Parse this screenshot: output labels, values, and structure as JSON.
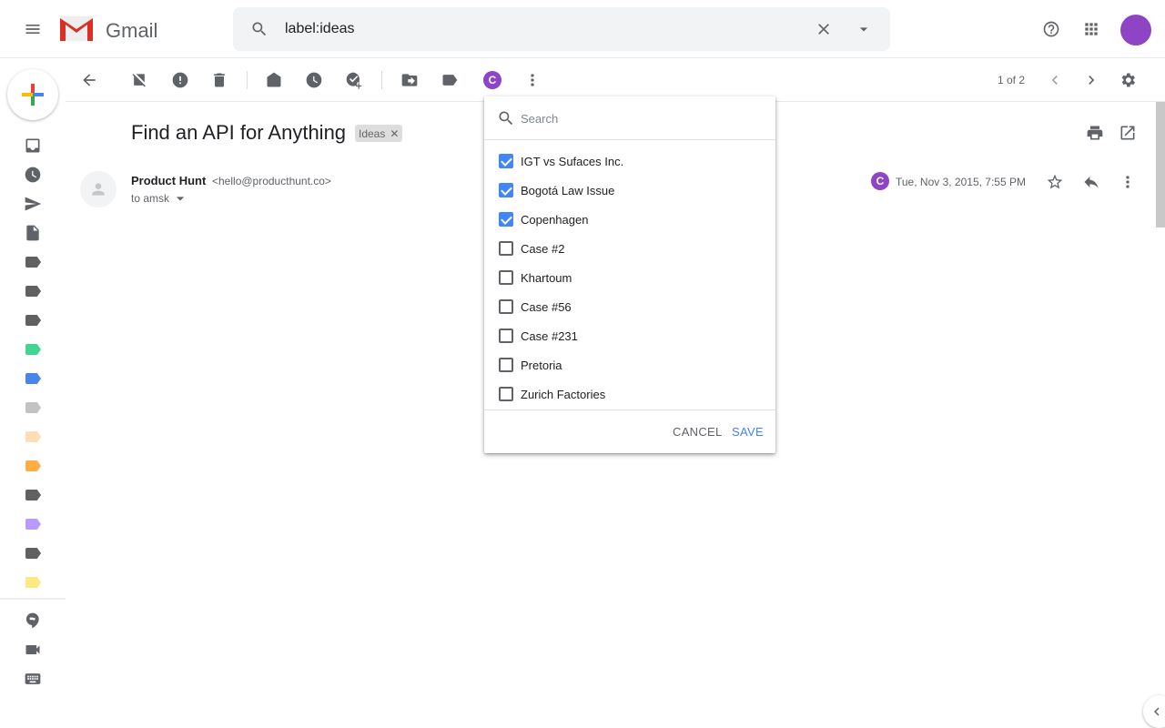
{
  "header": {
    "app_name": "Gmail",
    "search_value": "label:ideas"
  },
  "toolbar": {
    "pagination": "1 of 2",
    "label_avatar": "C"
  },
  "email": {
    "subject": "Find an API for Anything",
    "chip": "Ideas",
    "sender_name": "Product Hunt",
    "sender_email": "<hello@producthunt.co>",
    "to": "to amsk",
    "date": "Tue, Nov 3, 2015, 7:55 PM",
    "avatar_letter": "C"
  },
  "sidebar": {
    "label_colors": [
      "#616161",
      "#616161",
      "#616161",
      "#42d692",
      "#4a86e8",
      "#c2c2c2",
      "#ffdeb5",
      "#ffad47",
      "#616161",
      "#b99aff",
      "#616161",
      "#fbe983"
    ]
  },
  "label_menu": {
    "search_placeholder": "Search",
    "items": [
      {
        "label": "IGT vs Sufaces Inc.",
        "checked": true
      },
      {
        "label": "Bogotá Law Issue",
        "checked": true
      },
      {
        "label": "Copenhagen",
        "checked": true
      },
      {
        "label": "Case #2",
        "checked": false
      },
      {
        "label": "Khartoum",
        "checked": false
      },
      {
        "label": "Case #56",
        "checked": false
      },
      {
        "label": "Case #231",
        "checked": false
      },
      {
        "label": "Pretoria",
        "checked": false
      },
      {
        "label": "Zurich Factories",
        "checked": false
      }
    ],
    "cancel": "CANCEL",
    "save": "SAVE"
  },
  "colors": {
    "accent": "#1a73e8",
    "checkbox": "#4285f4",
    "avatar": "#8e44c4"
  }
}
